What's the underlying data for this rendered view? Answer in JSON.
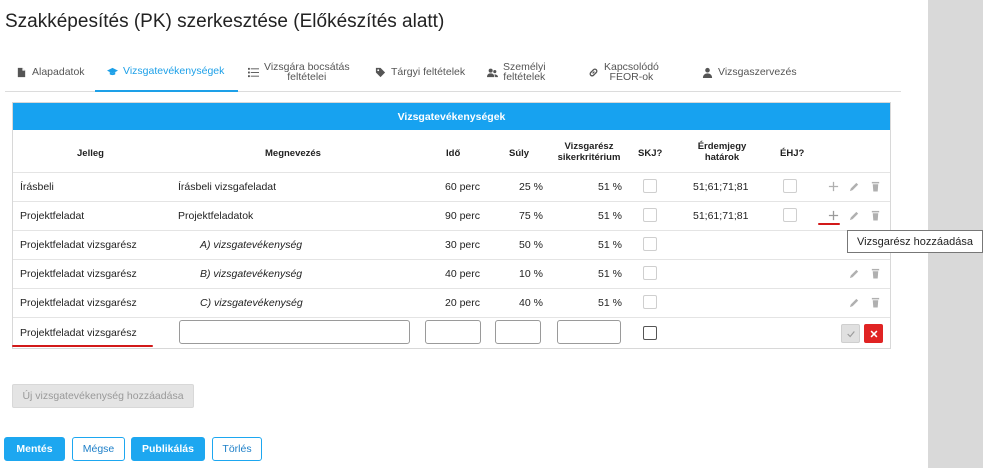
{
  "page": {
    "title": "Szakképesítés (PK) szerkesztése (Előkészítés alatt)"
  },
  "tabs": [
    {
      "label": "Alapadatok",
      "icon": "document-icon"
    },
    {
      "label": "Vizsgatevékenységek",
      "icon": "graduation-cap-icon",
      "active": true
    },
    {
      "label": "Vizsgára bocsátás\nfeltételei",
      "icon": "list-icon"
    },
    {
      "label": "Tárgyi feltételek",
      "icon": "tag-icon"
    },
    {
      "label": "Személyi\nfeltételek",
      "icon": "users-icon"
    },
    {
      "label": "Kapcsolódó\nFEOR-ok",
      "icon": "link-icon"
    },
    {
      "label": "Vizsgaszervezés",
      "icon": "user-icon"
    }
  ],
  "panel": {
    "title": "Vizsgatevékenységek",
    "columns": {
      "jelleg": "Jelleg",
      "megnevezes": "Megnevezés",
      "ido": "Idő",
      "suly": "Súly",
      "kriterium": "Vizsgarész\nsikerkritérium",
      "skj": "SKJ?",
      "erdemjegy": "Érdemjegy\nhatárok",
      "ehj": "ÉHJ?"
    },
    "rows": [
      {
        "jelleg": "Írásbeli",
        "megnevezes": "Írásbeli vizsgafeladat",
        "ido": "60 perc",
        "suly": "25 %",
        "kriterium": "51 %",
        "erdemjegy": "51;61;71;81"
      },
      {
        "jelleg": "Projektfeladat",
        "megnevezes": "Projektfeladatok",
        "ido": "90 perc",
        "suly": "75 %",
        "kriterium": "51 %",
        "erdemjegy": "51;61;71;81"
      },
      {
        "jelleg": "Projektfeladat vizsgarész",
        "megnevezes": "A) vizsgatevékenység",
        "ido": "30 perc",
        "suly": "50 %",
        "kriterium": "51 %",
        "erdemjegy": ""
      },
      {
        "jelleg": "Projektfeladat vizsgarész",
        "megnevezes": "B) vizsgatevékenység",
        "ido": "40 perc",
        "suly": "10 %",
        "kriterium": "51 %",
        "erdemjegy": ""
      },
      {
        "jelleg": "Projektfeladat vizsgarész",
        "megnevezes": "C) vizsgatevékenység",
        "ido": "20 perc",
        "suly": "40 %",
        "kriterium": "51 %",
        "erdemjegy": ""
      }
    ],
    "new_row": {
      "jelleg": "Projektfeladat vizsgarész",
      "megnevezes_value": "",
      "ido_value": "",
      "suly_value": "",
      "kriterium_value": ""
    }
  },
  "tooltip": "Vizsgarész hozzáadása",
  "buttons": {
    "add_activity": "Új vizsgatevékenység hozzáadása",
    "save": "Mentés",
    "cancel": "Mégse",
    "publish": "Publikálás",
    "delete": "Törlés"
  },
  "colors": {
    "accent": "#17a2f0",
    "danger": "#e02323",
    "highlight": "#d21919"
  }
}
